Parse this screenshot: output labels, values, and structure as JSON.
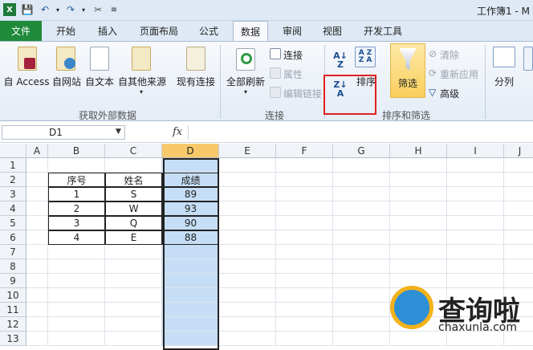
{
  "titlebar": {
    "title": "工作簿1 - M"
  },
  "tabs": [
    {
      "id": "file",
      "label": "文件"
    },
    {
      "id": "home",
      "label": "开始"
    },
    {
      "id": "insert",
      "label": "插入"
    },
    {
      "id": "layout",
      "label": "页面布局"
    },
    {
      "id": "formulas",
      "label": "公式"
    },
    {
      "id": "data",
      "label": "数据",
      "active": true
    },
    {
      "id": "review",
      "label": "审阅"
    },
    {
      "id": "view",
      "label": "视图"
    },
    {
      "id": "developer",
      "label": "开发工具"
    }
  ],
  "ribbon": {
    "external": {
      "access": "自 Access",
      "web": "自网站",
      "text": "自文本",
      "other": "自其他来源",
      "existing": "现有连接",
      "group": "获取外部数据"
    },
    "connections": {
      "refresh": "全部刷新",
      "connections": "连接",
      "properties": "属性",
      "edit_links": "编辑链接",
      "group": "连接"
    },
    "sort_filter": {
      "sort": "排序",
      "filter": "筛选",
      "clear": "清除",
      "reapply": "重新应用",
      "advanced": "高级",
      "group": "排序和筛选"
    },
    "tools": {
      "split": "分列"
    }
  },
  "formula_bar": {
    "cell_ref": "D1",
    "fx": "fx",
    "value": ""
  },
  "sheet": {
    "columns": [
      "A",
      "B",
      "C",
      "D",
      "E",
      "F",
      "G",
      "H",
      "I",
      "J"
    ],
    "selected_column": "D",
    "rows": [
      "1",
      "2",
      "3",
      "4",
      "5",
      "6",
      "7",
      "8",
      "9",
      "10",
      "11",
      "12",
      "13"
    ],
    "table": {
      "headers": [
        "序号",
        "姓名",
        "成绩"
      ],
      "rows": [
        [
          "1",
          "S",
          "89"
        ],
        [
          "2",
          "W",
          "93"
        ],
        [
          "3",
          "Q",
          "90"
        ],
        [
          "4",
          "E",
          "88"
        ]
      ]
    }
  },
  "watermark": {
    "brand": "查询啦",
    "domain": "chaxunla.com"
  },
  "colors": {
    "file_tab": "#1f8a3a",
    "selection": "#c5def5",
    "highlight": "#e02020",
    "header_selected": "#f7c96a"
  }
}
